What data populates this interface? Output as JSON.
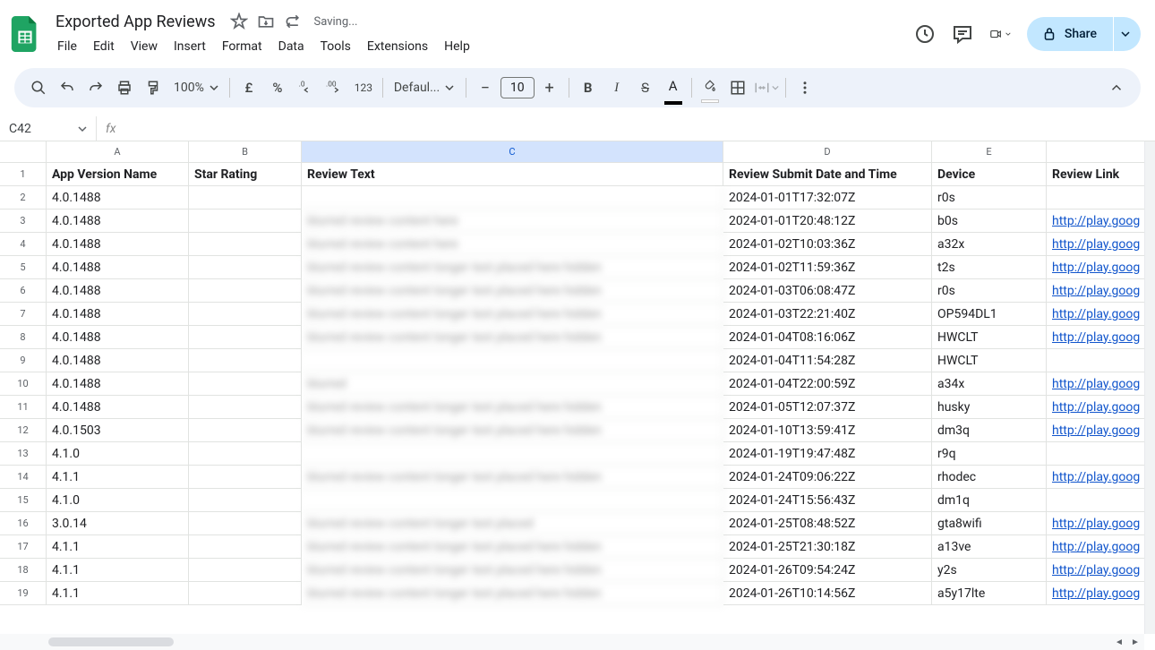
{
  "doc_title": "Exported App Reviews",
  "saving_text": "Saving...",
  "menu": [
    "File",
    "Edit",
    "View",
    "Insert",
    "Format",
    "Data",
    "Tools",
    "Extensions",
    "Help"
  ],
  "share_label": "Share",
  "toolbar": {
    "zoom": "100%",
    "font": "Defaul...",
    "font_size": "10"
  },
  "namebox": "C42",
  "columns": [
    "A",
    "B",
    "C",
    "D",
    "E",
    ""
  ],
  "selected_col": "C",
  "headers": {
    "A": "App Version Name",
    "B": "Star Rating",
    "C": "Review Text",
    "D": "Review Submit Date and Time",
    "E": "Device",
    "F": "Review Link"
  },
  "rows": [
    {
      "n": 2,
      "a": "4.0.1488",
      "c": "",
      "d": "2024-01-01T17:32:07Z",
      "e": "r0s",
      "f": ""
    },
    {
      "n": 3,
      "a": "4.0.1488",
      "c": "blurred review content here",
      "d": "2024-01-01T20:48:12Z",
      "e": "b0s",
      "f": "http://play.goog"
    },
    {
      "n": 4,
      "a": "4.0.1488",
      "c": "blurred review content here",
      "d": "2024-01-02T10:03:36Z",
      "e": "a32x",
      "f": "http://play.goog"
    },
    {
      "n": 5,
      "a": "4.0.1488",
      "c": "blurred review content longer text placed here hidden",
      "d": "2024-01-02T11:59:36Z",
      "e": "t2s",
      "f": "http://play.goog"
    },
    {
      "n": 6,
      "a": "4.0.1488",
      "c": "blurred review content longer text placed here hidden",
      "d": "2024-01-03T06:08:47Z",
      "e": "r0s",
      "f": "http://play.goog"
    },
    {
      "n": 7,
      "a": "4.0.1488",
      "c": "blurred review content longer text placed here hidden",
      "d": "2024-01-03T22:21:40Z",
      "e": "OP594DL1",
      "f": "http://play.goog"
    },
    {
      "n": 8,
      "a": "4.0.1488",
      "c": "blurred review content longer text placed here hidden",
      "d": "2024-01-04T08:16:06Z",
      "e": "HWCLT",
      "f": "http://play.goog"
    },
    {
      "n": 9,
      "a": "4.0.1488",
      "c": "",
      "d": "2024-01-04T11:54:28Z",
      "e": "HWCLT",
      "f": ""
    },
    {
      "n": 10,
      "a": "4.0.1488",
      "c": "blurred",
      "d": "2024-01-04T22:00:59Z",
      "e": "a34x",
      "f": "http://play.goog"
    },
    {
      "n": 11,
      "a": "4.0.1488",
      "c": "blurred review content longer text placed here hidden",
      "d": "2024-01-05T12:07:37Z",
      "e": "husky",
      "f": "http://play.goog"
    },
    {
      "n": 12,
      "a": "4.0.1503",
      "c": "blurred review content longer text placed here hidden",
      "d": "2024-01-10T13:59:41Z",
      "e": "dm3q",
      "f": "http://play.goog"
    },
    {
      "n": 13,
      "a": "4.1.0",
      "c": "",
      "d": "2024-01-19T19:47:48Z",
      "e": "r9q",
      "f": ""
    },
    {
      "n": 14,
      "a": "4.1.1",
      "c": "blurred review content longer text placed here hidden",
      "d": "2024-01-24T09:06:22Z",
      "e": "rhodec",
      "f": "http://play.goog"
    },
    {
      "n": 15,
      "a": "4.1.0",
      "c": "",
      "d": "2024-01-24T15:56:43Z",
      "e": "dm1q",
      "f": ""
    },
    {
      "n": 16,
      "a": "3.0.14",
      "c": "blurred review content longer text placed",
      "d": "2024-01-25T08:48:52Z",
      "e": "gta8wifi",
      "f": "http://play.goog"
    },
    {
      "n": 17,
      "a": "4.1.1",
      "c": "blurred review content longer text placed here hidden",
      "d": "2024-01-25T21:30:18Z",
      "e": "a13ve",
      "f": "http://play.goog"
    },
    {
      "n": 18,
      "a": "4.1.1",
      "c": "blurred review content longer text placed here hidden",
      "d": "2024-01-26T09:54:24Z",
      "e": "y2s",
      "f": "http://play.goog"
    },
    {
      "n": 19,
      "a": "4.1.1",
      "c": "blurred review content longer text placed here hidden",
      "d": "2024-01-26T10:14:56Z",
      "e": "a5y17lte",
      "f": "http://play.goog"
    }
  ]
}
